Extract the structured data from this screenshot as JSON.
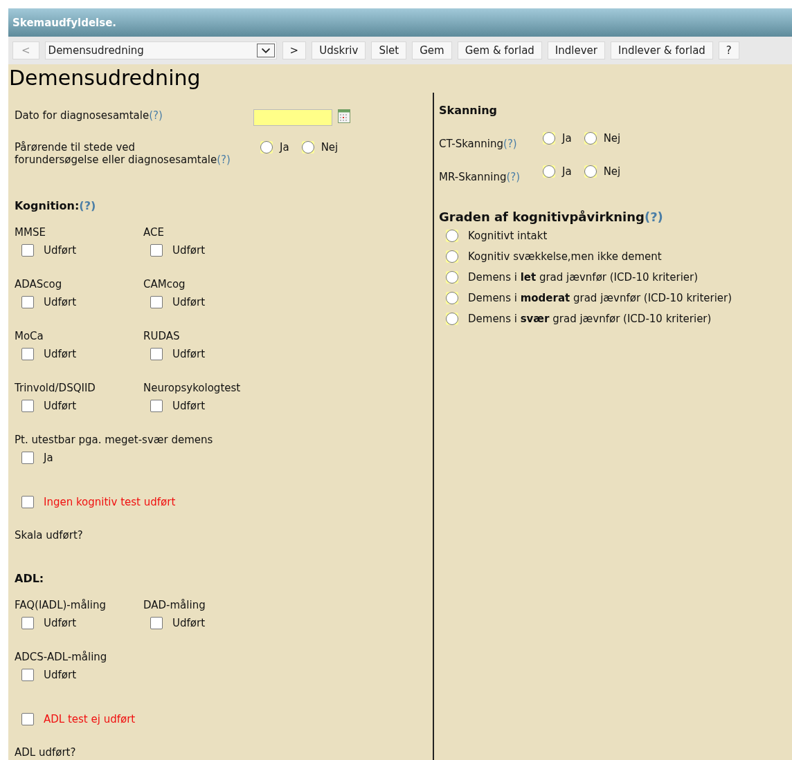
{
  "window": {
    "title": "Skemaudfyldelse."
  },
  "toolbar": {
    "prev": {
      "label": "<",
      "disabled": true
    },
    "form_select": {
      "value": "Demensudredning"
    },
    "next": {
      "label": ">",
      "disabled": false
    },
    "buttons": [
      "Udskriv",
      "Slet",
      "Gem",
      "Gem & forlad",
      "Indlever",
      "Indlever & forlad",
      "?"
    ]
  },
  "heading": "Demensudredning",
  "left": [
    {
      "kind": "date",
      "label": "Dato for diagnosesamtale",
      "help": "(?)"
    },
    {
      "kind": "radio",
      "label": "Pårørende til stede ved\nforundersøgelse eller diagnosesamtale",
      "help": "(?)",
      "options": [
        {
          "label": "Ja",
          "selected": false
        },
        {
          "label": "Nej",
          "selected": false
        }
      ]
    },
    {
      "kind": "section",
      "label": "Kognition:",
      "help": "(?)"
    },
    {
      "kind": "checkpair",
      "items": [
        {
          "label": "MMSE",
          "option": "Udført",
          "checked": false
        },
        {
          "label": "ACE",
          "option": "Udført",
          "checked": false
        }
      ]
    },
    {
      "kind": "checkpair",
      "items": [
        {
          "label": "ADAScog",
          "option": "Udført",
          "checked": false
        },
        {
          "label": "CAMcog",
          "option": "Udført",
          "checked": false
        }
      ]
    },
    {
      "kind": "checkpair",
      "items": [
        {
          "label": "MoCa",
          "option": "Udført",
          "checked": false
        },
        {
          "label": "RUDAS",
          "option": "Udført",
          "checked": false
        }
      ]
    },
    {
      "kind": "checkpair",
      "items": [
        {
          "label": "Trinvold/DSQIID",
          "option": "Udført",
          "checked": false
        },
        {
          "label": "Neuropsykologtest",
          "option": "Udført",
          "checked": false
        }
      ]
    },
    {
      "kind": "checkpair",
      "items": [
        {
          "label": "Pt. utestbar pga. meget-svær demens",
          "option": "Ja",
          "checked": false
        }
      ]
    },
    {
      "kind": "warncheck",
      "option": "Ingen kognitiv test udført",
      "checked": false
    },
    {
      "kind": "note",
      "label": "Skala udført?"
    },
    {
      "kind": "section",
      "label": "ADL:"
    },
    {
      "kind": "checkpair",
      "items": [
        {
          "label": "FAQ(IADL)-måling",
          "option": "Udført",
          "checked": false
        },
        {
          "label": "DAD-måling",
          "option": "Udført",
          "checked": false
        }
      ]
    },
    {
      "kind": "checkpair",
      "items": [
        {
          "label": "ADCS-ADL-måling",
          "option": "Udført",
          "checked": false
        }
      ]
    },
    {
      "kind": "warncheck",
      "option": "ADL test ej udført",
      "checked": false
    },
    {
      "kind": "note",
      "label": "ADL udført?"
    }
  ],
  "right": [
    {
      "kind": "subheading",
      "label": "Skanning"
    },
    {
      "kind": "radio",
      "label": "CT-Skanning",
      "help": "(?)",
      "options": [
        {
          "label": "Ja",
          "selected": false
        },
        {
          "label": "Nej",
          "selected": false
        }
      ]
    },
    {
      "kind": "radio",
      "label": "MR-Skanning",
      "help": "(?)",
      "options": [
        {
          "label": "Ja",
          "selected": false
        },
        {
          "label": "Nej",
          "selected": false
        }
      ]
    },
    {
      "kind": "section",
      "label": "Graden af kognitivpåvirkning",
      "help": "(?)"
    },
    {
      "kind": "radiolist",
      "options": [
        {
          "label": "Kognitivt intakt",
          "selected": false
        },
        {
          "label": "Kognitiv svækkelse,men ikke dement",
          "selected": false
        },
        {
          "label": "Demens i **let** grad jævnfør (ICD-10 kriterier)",
          "selected": false
        },
        {
          "label": "Demens i **moderat** grad jævnfør (ICD-10 kriterier)",
          "selected": false
        },
        {
          "label": "Demens i **svær** grad jævnfør (ICD-10 kriterier)",
          "selected": false
        }
      ]
    }
  ]
}
